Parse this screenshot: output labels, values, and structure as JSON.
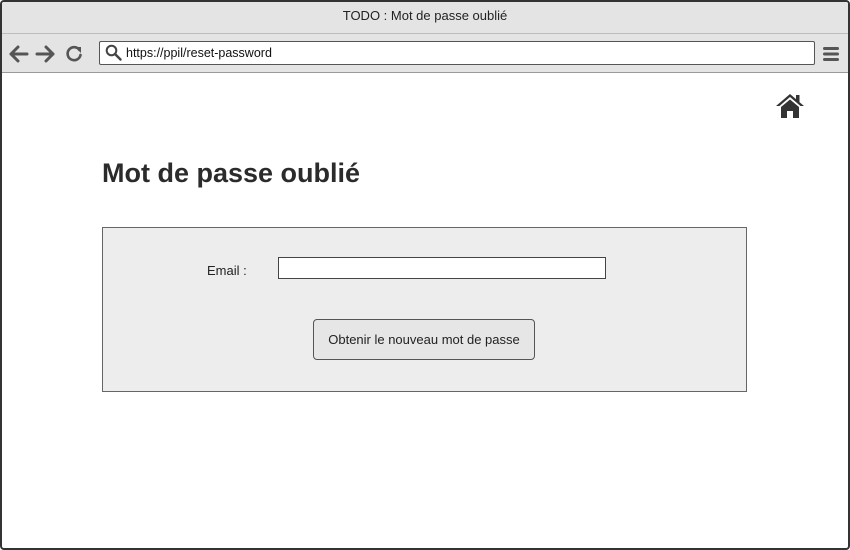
{
  "window": {
    "title": "TODO : Mot de passe oublié"
  },
  "toolbar": {
    "url": "https://ppil/reset-password",
    "icons": [
      "back-arrow-icon",
      "forward-arrow-icon",
      "reload-icon",
      "search-icon",
      "hamburger-menu-icon"
    ]
  },
  "header": {
    "home_icon": "home-icon"
  },
  "main": {
    "title": "Mot de passe oublié",
    "form": {
      "email_label": "Email :",
      "email_value": "",
      "submit_label": "Obtenir le nouveau mot de passe"
    }
  }
}
